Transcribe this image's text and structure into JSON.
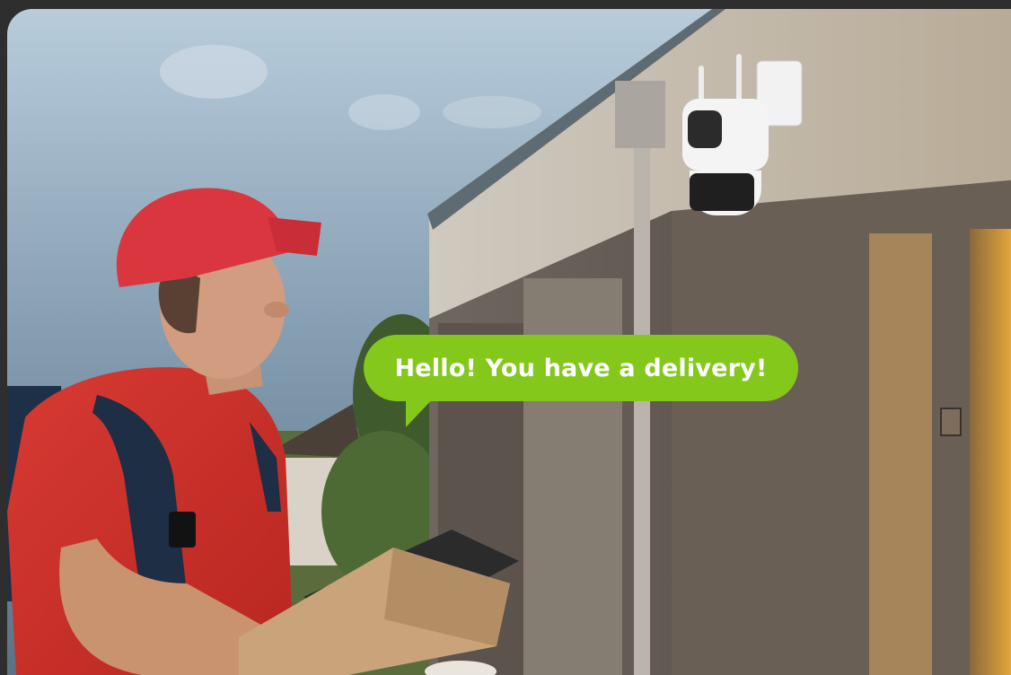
{
  "speech_bubble": {
    "text": "Hello! You have a delivery!",
    "color": "#84c81c"
  },
  "scene": {
    "subject": "delivery-person",
    "device": "security-camera-icon"
  }
}
